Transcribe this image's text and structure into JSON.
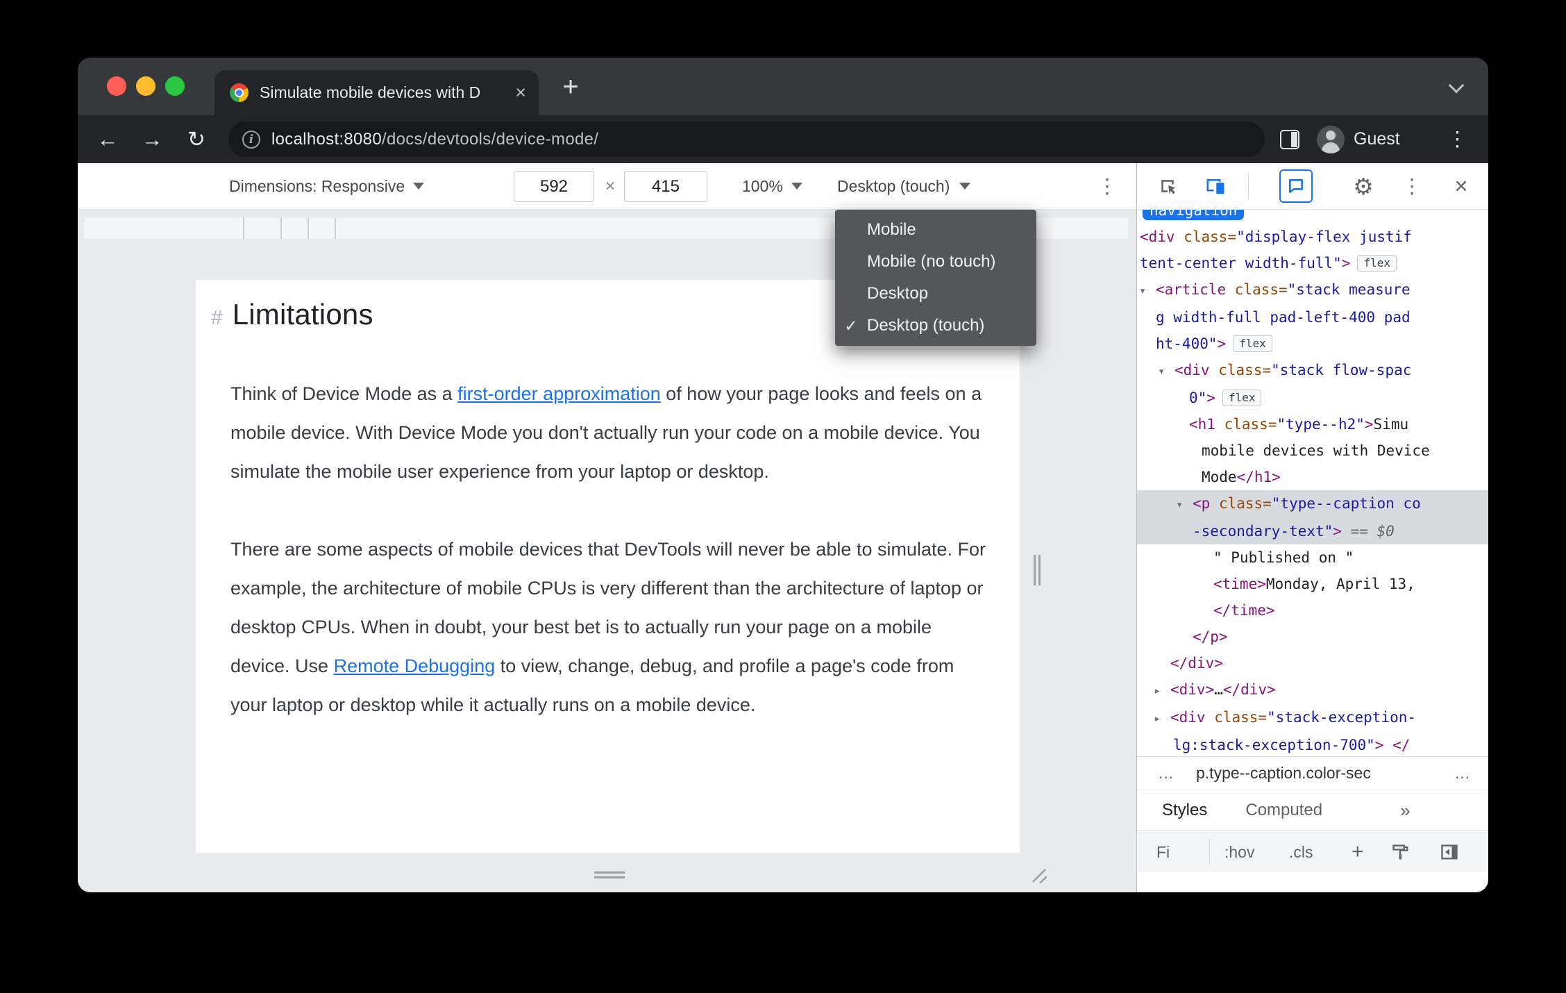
{
  "theme": {
    "accent_blue": "#1a73e8",
    "traffic_red": "#ff5f57",
    "traffic_yellow": "#febc2e",
    "traffic_green": "#28c840",
    "link_color": "#1a73e8",
    "code_tag_color": "#881280",
    "code_attr_color": "#994500",
    "code_value_color": "#1a1aa6",
    "selection_color": "#d7dade"
  },
  "icons": {
    "back": "←",
    "forward": "→",
    "reload": "↻",
    "close": "×",
    "new_tab": "+",
    "more_vertical": "⋮",
    "check": "✓",
    "expanded": "▾",
    "collapsed": "▸",
    "gear": "⚙",
    "info": "i"
  },
  "browser": {
    "tab_title": "Simulate mobile devices with D",
    "url_host": "localhost:8080",
    "url_path": "/docs/devtools/device-mode/",
    "profile_label": "Guest"
  },
  "device_toolbar": {
    "dimensions_label": "Dimensions: Responsive",
    "width_value": "592",
    "multiply": "×",
    "height_value": "415",
    "zoom_value": "100%",
    "device_type_value": "Desktop (touch)"
  },
  "dropdown": {
    "items": [
      {
        "label": "Mobile",
        "checked": false
      },
      {
        "label": "Mobile (no touch)",
        "checked": false
      },
      {
        "label": "Desktop",
        "checked": false
      },
      {
        "label": "Desktop (touch)",
        "checked": true
      }
    ]
  },
  "page": {
    "hash": "#",
    "heading": "Limitations",
    "paragraphs": [
      {
        "segments": [
          {
            "t": "Think of Device Mode as a "
          },
          {
            "t": "first-order approximation",
            "link": true
          },
          {
            "t": " of how your page looks and feels on a mobile device. With Device Mode you don't actually run your code on a mobile device. You simulate the mobile user experience from your laptop or desktop."
          }
        ]
      },
      {
        "segments": [
          {
            "t": "There are some aspects of mobile devices that DevTools will never be able to simulate. For example, the architecture of mobile CPUs is very different than the architecture of laptop or desktop CPUs. When in doubt, your best bet is to actually run your page on a mobile device. Use "
          },
          {
            "t": "Remote Debugging",
            "link": true
          },
          {
            "t": " to view, change, debug, and profile a page's code from your laptop or desktop while it actually runs on a mobile device."
          }
        ]
      }
    ]
  },
  "devtools": {
    "breadcrumb": {
      "left": "…",
      "crumb": "p.type--caption.color-sec",
      "right": "…"
    },
    "tabs": {
      "styles": "Styles",
      "computed": "Computed",
      "overflow": "»"
    },
    "filter": {
      "text": "Fi",
      "hov": ":hov",
      "cls": ".cls",
      "add": "+"
    },
    "code_lines": [
      {
        "partial": true,
        "pad": 8,
        "segs": [
          {
            "t": "navigation",
            "c": "hl"
          }
        ]
      },
      {
        "pad": 4,
        "segs": [
          {
            "t": "<div ",
            "c": "tag"
          },
          {
            "t": "class=",
            "c": "attr"
          },
          {
            "t": "\"display-flex justif",
            "c": "val"
          }
        ]
      },
      {
        "pad": 4,
        "segs": [
          {
            "t": "tent-center width-full\"",
            "c": "val"
          },
          {
            "t": ">",
            "c": "tag"
          }
        ],
        "badge": "flex"
      },
      {
        "pad": 3,
        "arrow": "down",
        "segs": [
          {
            "t": "<article ",
            "c": "tag"
          },
          {
            "t": "class=",
            "c": "attr"
          },
          {
            "t": "\"stack measure",
            "c": "val"
          }
        ]
      },
      {
        "pad": 27,
        "segs": [
          {
            "t": "g width-full pad-left-400 pad",
            "c": "val"
          }
        ]
      },
      {
        "pad": 27,
        "segs": [
          {
            "t": "ht-400\"",
            "c": "val"
          },
          {
            "t": ">",
            "c": "tag"
          }
        ],
        "badge": "flex"
      },
      {
        "pad": 30,
        "arrow": "down",
        "segs": [
          {
            "t": "<div ",
            "c": "tag"
          },
          {
            "t": "class=",
            "c": "attr"
          },
          {
            "t": "\"stack flow-spac",
            "c": "val"
          }
        ]
      },
      {
        "pad": 75,
        "segs": [
          {
            "t": "0\"",
            "c": "val"
          },
          {
            "t": ">",
            "c": "tag"
          }
        ],
        "badge": "flex"
      },
      {
        "pad": 75,
        "segs": [
          {
            "t": "<h1 ",
            "c": "tag"
          },
          {
            "t": "class=",
            "c": "attr"
          },
          {
            "t": "\"type--h2\"",
            "c": "val"
          },
          {
            "t": ">",
            "c": "tag"
          },
          {
            "t": "Simu",
            "c": "txt"
          }
        ]
      },
      {
        "pad": 93,
        "segs": [
          {
            "t": "mobile devices with Device",
            "c": "txt"
          }
        ]
      },
      {
        "pad": 93,
        "segs": [
          {
            "t": "Mode",
            "c": "txt"
          },
          {
            "t": "</h1>",
            "c": "tag"
          }
        ]
      },
      {
        "pad": 56,
        "arrow": "down",
        "sel": true,
        "segs": [
          {
            "t": "<p ",
            "c": "tag"
          },
          {
            "t": "class=",
            "c": "attr"
          },
          {
            "t": "\"type--caption co",
            "c": "val"
          }
        ]
      },
      {
        "pad": 80,
        "sel": true,
        "segs": [
          {
            "t": "-secondary-text\"",
            "c": "val"
          },
          {
            "t": ">",
            "c": "tag"
          },
          {
            "t": " == ",
            "c": "op"
          },
          {
            "t": "$0",
            "c": "var"
          }
        ]
      },
      {
        "pad": 110,
        "segs": [
          {
            "t": "\" Published on \"",
            "c": "txt"
          }
        ]
      },
      {
        "pad": 110,
        "segs": [
          {
            "t": "<time>",
            "c": "tag"
          },
          {
            "t": "Monday, April 13, ",
            "c": "txt"
          }
        ]
      },
      {
        "pad": 110,
        "segs": [
          {
            "t": "</time>",
            "c": "tag"
          }
        ]
      },
      {
        "pad": 80,
        "segs": [
          {
            "t": "</p>",
            "c": "tag"
          }
        ]
      },
      {
        "pad": 48,
        "segs": [
          {
            "t": "</div>",
            "c": "tag"
          }
        ]
      },
      {
        "pad": 24,
        "arrow": "right",
        "segs": [
          {
            "t": "<div>",
            "c": "tag"
          },
          {
            "t": "…",
            "c": "txt"
          },
          {
            "t": "</div>",
            "c": "tag"
          }
        ]
      },
      {
        "pad": 24,
        "arrow": "right",
        "segs": [
          {
            "t": "<div ",
            "c": "tag"
          },
          {
            "t": "class=",
            "c": "attr"
          },
          {
            "t": "\"stack-exception-",
            "c": "val"
          }
        ]
      },
      {
        "pad": 52,
        "segs": [
          {
            "t": "lg:stack-exception-700\"",
            "c": "val"
          },
          {
            "t": "> </",
            "c": "tag"
          }
        ]
      }
    ]
  }
}
